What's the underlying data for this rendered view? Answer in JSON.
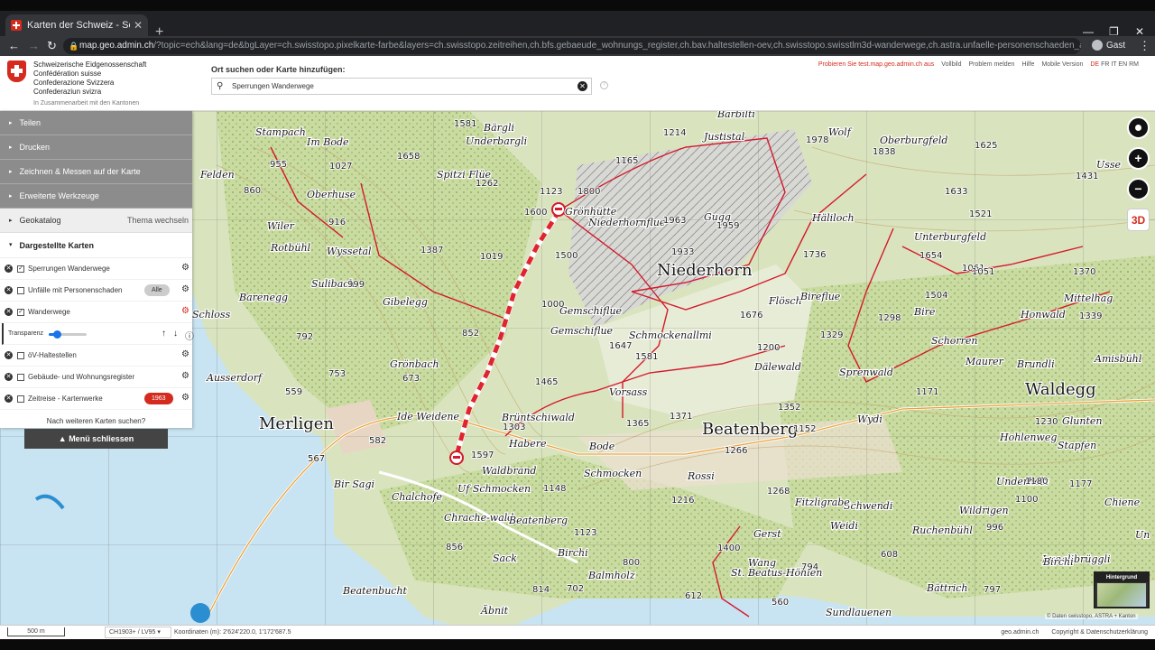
{
  "browser": {
    "tab_title": "Karten der Schweiz - Schweizeris",
    "url_host": "map.geo.admin.ch",
    "url_rest": "/?topic=ech&lang=de&bgLayer=ch.swisstopo.pixelkarte-farbe&layers=ch.swisstopo.zeitreihen,ch.bfs.gebaeude_wohnungs_register,ch.bav.haltestellen-oev,ch.swisstopo.swisstlm3d-wanderwege,ch.astra.unfaelle-personenschaeden_alle,ch.astra.wan...",
    "profile": "Gast"
  },
  "header": {
    "confed_lines": [
      "Schweizerische Eidgenossenschaft",
      "Confédération suisse",
      "Confederazione Svizzera",
      "Confederaziun svizra"
    ],
    "confed_sub": "In Zusammenarbeit mit den Kantonen",
    "search_label": "Ort suchen oder Karte hinzufügen:",
    "search_value": "Sperrungen Wanderwege",
    "links": [
      "Probieren Sie test.map.geo.admin.ch aus",
      "Vollbild",
      "Problem melden",
      "Hilfe",
      "Mobile Version"
    ],
    "languages": [
      "DE",
      "FR",
      "IT",
      "EN",
      "RM"
    ],
    "active_language": "DE"
  },
  "panel": {
    "sections": [
      "Teilen",
      "Drucken",
      "Zeichnen & Messen auf der Karte",
      "Erweiterte Werkzeuge"
    ],
    "geokatalog": "Geokatalog",
    "theme_switch": "Thema wechseln",
    "displayed_maps": "Dargestellte Karten",
    "layers": [
      {
        "label": "Sperrungen Wanderwege",
        "checked": true
      },
      {
        "label": "Unfälle mit Personenschaden",
        "checked": false,
        "badge": "Alle"
      },
      {
        "label": "Wanderwege",
        "checked": true
      },
      {
        "label": "öV-Haltestellen",
        "checked": false
      },
      {
        "label": "Gebäude- und Wohnungsregister",
        "checked": false
      },
      {
        "label": "Zeitreise - Kartenwerke",
        "checked": false,
        "badge": "1963"
      }
    ],
    "transparency_label": "Transparenz",
    "transparency_value": 0.22,
    "more_maps": "Nach weiteren Karten suchen?",
    "close_menu": "Menü schliessen"
  },
  "map": {
    "labels": [
      {
        "t": "Niederhorn",
        "big": true
      },
      {
        "t": "Beatenberg",
        "big": true
      },
      {
        "t": "Merligen",
        "big": true
      },
      {
        "t": "Waldegg",
        "big": true
      },
      {
        "t": "Burgfeld"
      },
      {
        "t": "Oberburgfeld"
      },
      {
        "t": "Unterburgfeld"
      },
      {
        "t": "Ausserdorf"
      },
      {
        "t": "Grönhütte"
      },
      {
        "t": "Spitzi Flüe"
      },
      {
        "t": "Underbargli"
      },
      {
        "t": "Im Bode"
      },
      {
        "t": "Oberhuse"
      },
      {
        "t": "Wiler"
      },
      {
        "t": "Rotbühl"
      },
      {
        "t": "Wyssetal"
      },
      {
        "t": "Gibelegg"
      },
      {
        "t": "Barenegg"
      },
      {
        "t": "Gemschiflue"
      },
      {
        "t": "Schmockenallmi"
      },
      {
        "t": "Häliloch"
      },
      {
        "t": "Flösch"
      },
      {
        "t": "Bireflue"
      },
      {
        "t": "Bire"
      },
      {
        "t": "Mittelhag"
      },
      {
        "t": "Honwald"
      },
      {
        "t": "Amisbühl"
      },
      {
        "t": "Brundli"
      },
      {
        "t": "Maurer"
      },
      {
        "t": "Schorren"
      },
      {
        "t": "Sprenwald"
      },
      {
        "t": "Vorsass"
      },
      {
        "t": "Brüntschiwald"
      },
      {
        "t": "Habere"
      },
      {
        "t": "Bode"
      },
      {
        "t": "Waldbrand"
      },
      {
        "t": "Schmocken"
      },
      {
        "t": "Rossi"
      },
      {
        "t": "Chalchofe"
      },
      {
        "t": "Chrache-wald"
      },
      {
        "t": "Bir Sagi"
      },
      {
        "t": "Sack"
      },
      {
        "t": "Birchi"
      },
      {
        "t": "Balmholz"
      },
      {
        "t": "Beatenbucht"
      },
      {
        "t": "Äbnit"
      },
      {
        "t": "Wang"
      },
      {
        "t": "St. Beatus-Höhlen"
      },
      {
        "t": "Sundlauenen"
      },
      {
        "t": "Bättrich"
      },
      {
        "t": "Lueglibrüggli"
      },
      {
        "t": "Ruchenbühl"
      },
      {
        "t": "Wildrigen"
      },
      {
        "t": "Schwendi"
      },
      {
        "t": "Weidi"
      },
      {
        "t": "Hohlenweg"
      },
      {
        "t": "Underholz"
      },
      {
        "t": "Stapfen"
      },
      {
        "t": "Glunten"
      },
      {
        "t": "Wydi"
      },
      {
        "t": "Felden"
      },
      {
        "t": "Schloss"
      },
      {
        "t": "Stampach"
      },
      {
        "t": "Sulibach"
      },
      {
        "t": "Grönbach"
      },
      {
        "t": "Ide Weidene"
      },
      {
        "t": "Uf Schmocken"
      },
      {
        "t": "Dälewald"
      },
      {
        "t": "Gugg"
      },
      {
        "t": "Niederhornflue"
      },
      {
        "t": "Fitzligrabe"
      },
      {
        "t": "Justistal"
      },
      {
        "t": "Bärgli"
      },
      {
        "t": "Gemschiflue"
      },
      {
        "t": "Bärbilti"
      },
      {
        "t": "Usse"
      },
      {
        "t": "Wolf"
      },
      {
        "t": "Birchi"
      },
      {
        "t": "Chiene"
      },
      {
        "t": "Beatenberg"
      },
      {
        "t": "Gerst"
      },
      {
        "t": "Un"
      }
    ],
    "spot_heights": [
      "1581",
      "1214",
      "1165",
      "1978",
      "1838",
      "1625",
      "1431",
      "1658",
      "1262",
      "1123",
      "1963",
      "1959",
      "1933",
      "1736",
      "1633",
      "1521",
      "1654",
      "1061",
      "1051",
      "1370",
      "1019",
      "1387",
      "1298",
      "1504",
      "1339",
      "852",
      "1676",
      "1647",
      "1581",
      "1329",
      "1352",
      "1465",
      "1171",
      "1365",
      "1371",
      "1303",
      "1266",
      "1152",
      "1230",
      "1180",
      "582",
      "567",
      "1597",
      "1148",
      "1123",
      "1216",
      "1268",
      "1177",
      "996",
      "794",
      "797",
      "856",
      "814",
      "702",
      "612",
      "608",
      "560",
      "1100",
      "955",
      "916",
      "999",
      "860",
      "1027",
      "753",
      "559",
      "792",
      "673",
      "1500",
      "1000",
      "1400",
      "1600",
      "1200",
      "1800",
      "800"
    ],
    "background_label": "Hintergrund",
    "copyright": "© Daten swisstopo, ASTRA + Kanton"
  },
  "controls": {
    "zoom_in": "+",
    "zoom_out": "−",
    "btn_3d": "3D"
  },
  "footer": {
    "scale": "500 m",
    "crs": "CH1903+ / LV95",
    "coords_label": "Koordinaten (m): 2'624'220.0, 1'172'687.5",
    "links": [
      "geo.admin.ch",
      "Copyright & Datenschutzerklärung"
    ]
  }
}
